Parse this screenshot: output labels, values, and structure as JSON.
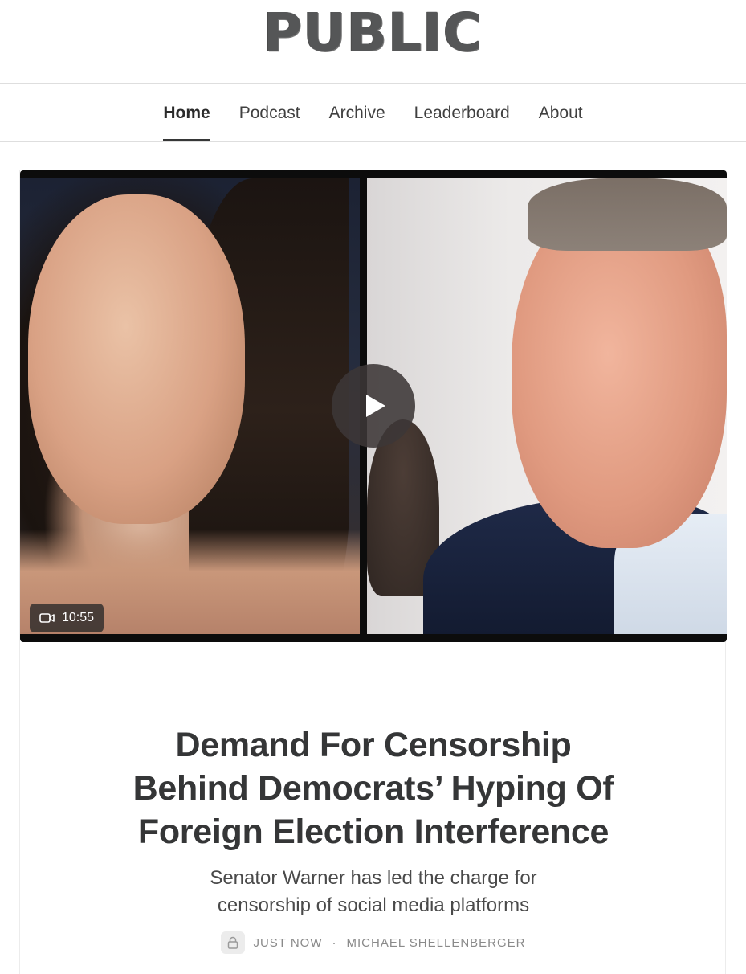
{
  "masthead": {
    "logo_text": "PUBLIC"
  },
  "nav": {
    "items": [
      {
        "label": "Home",
        "active": true
      },
      {
        "label": "Podcast",
        "active": false
      },
      {
        "label": "Archive",
        "active": false
      },
      {
        "label": "Leaderboard",
        "active": false
      },
      {
        "label": "About",
        "active": false
      }
    ]
  },
  "video": {
    "duration": "10:55",
    "icons": {
      "play": "play-icon",
      "camera": "video-camera-icon"
    }
  },
  "article": {
    "title_lines": [
      "Demand For Censorship",
      "Behind Democrats’ Hyping Of",
      "Foreign Election Interference"
    ],
    "subtitle_lines": [
      "Senator Warner has led the charge for",
      "censorship of social media platforms"
    ],
    "meta": {
      "lock_icon": "lock-icon",
      "time": "JUST NOW",
      "separator": "·",
      "author": "MICHAEL SHELLENBERGER"
    }
  },
  "colors": {
    "text_primary": "#363737",
    "nav_underline": "#363737",
    "meta_text": "#8a8a8a",
    "divider": "#dedede"
  }
}
